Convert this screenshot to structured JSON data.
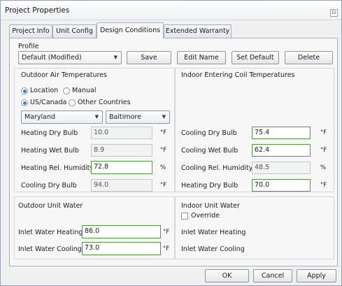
{
  "window": {
    "title": "Project Properties",
    "restore_glyph": "⊡"
  },
  "tabs": [
    {
      "label": "Project Info"
    },
    {
      "label": "Unit Config"
    },
    {
      "label": "Design Conditions"
    },
    {
      "label": "Extended Warranty"
    }
  ],
  "profile": {
    "label": "Profile",
    "selected": "Default (Modified)",
    "buttons": {
      "save": "Save",
      "edit_name": "Edit Name",
      "set_default": "Set Default",
      "delete": "Delete"
    }
  },
  "outdoor_air": {
    "title": "Outdoor Air Temperatures",
    "radio_location": "Location",
    "radio_manual": "Manual",
    "radio_us_canada": "US/Canada",
    "radio_other": "Other Countries",
    "state": "Maryland",
    "city": "Baltimore",
    "rows": [
      {
        "label": "Heating Dry Bulb",
        "value": "10.0",
        "unit": "°F"
      },
      {
        "label": "Heating Wet Bulb",
        "value": "8.9",
        "unit": "°F"
      },
      {
        "label": "Heating Rel. Humidity",
        "value": "72.8",
        "unit": "%"
      },
      {
        "label": "Cooling Dry Bulb",
        "value": "94.0",
        "unit": "°F"
      }
    ]
  },
  "indoor_coil": {
    "title": "Indoor Entering Coil Temperatures",
    "rows": [
      {
        "label": "Cooling Dry Bulb",
        "value": "75.4",
        "unit": "°F"
      },
      {
        "label": "Cooling Wet Bulb",
        "value": "62.4",
        "unit": "°F"
      },
      {
        "label": "Cooling Rel. Humidity",
        "value": "48.5",
        "unit": "%"
      },
      {
        "label": "Heating Dry Bulb",
        "value": "70.0",
        "unit": "°F"
      }
    ]
  },
  "outdoor_water": {
    "title": "Outdoor Unit Water",
    "rows": [
      {
        "label": "Inlet Water Heating",
        "value": "86.0",
        "unit": "°F"
      },
      {
        "label": "Inlet Water Cooling",
        "value": "73.0",
        "unit": "°F"
      }
    ]
  },
  "indoor_water": {
    "title": "Indoor Unit Water",
    "override": "Override",
    "rows": [
      {
        "label": "Inlet Water Heating"
      },
      {
        "label": "Inlet Water Cooling"
      }
    ]
  },
  "footer": {
    "ok": "OK",
    "cancel": "Cancel",
    "apply": "Apply"
  },
  "colors": {
    "edit_border": "#4e9a3c",
    "radio_dot": "#3c7fd0"
  }
}
